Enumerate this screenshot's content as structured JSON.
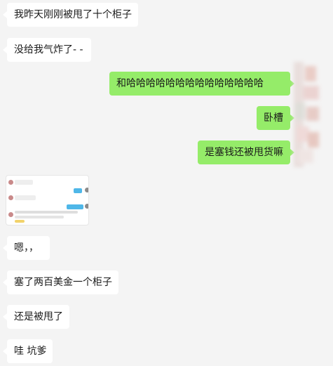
{
  "messages": [
    {
      "side": "in",
      "text": "我昨天刚刚被甩了十个柜子"
    },
    {
      "side": "in",
      "text": "没给我气炸了- -"
    },
    {
      "side": "out",
      "text": "和哈哈哈哈哈哈哈哈哈哈哈哈哈哈"
    },
    {
      "side": "out",
      "text": "卧槽"
    },
    {
      "side": "out",
      "text": "是塞钱还被甩货嘛"
    },
    {
      "side": "in",
      "type": "image",
      "description": "chat-screenshot-thumbnail"
    },
    {
      "side": "in",
      "text": "嗯，，"
    },
    {
      "side": "in",
      "text": "塞了两百美金一个柜子"
    },
    {
      "side": "in",
      "text": "还是被甩了"
    },
    {
      "side": "in",
      "text": "哇 坑爹"
    }
  ],
  "colors": {
    "background": "#f4f4f4",
    "incoming_bubble": "#ffffff",
    "outgoing_bubble": "#95ec69"
  }
}
